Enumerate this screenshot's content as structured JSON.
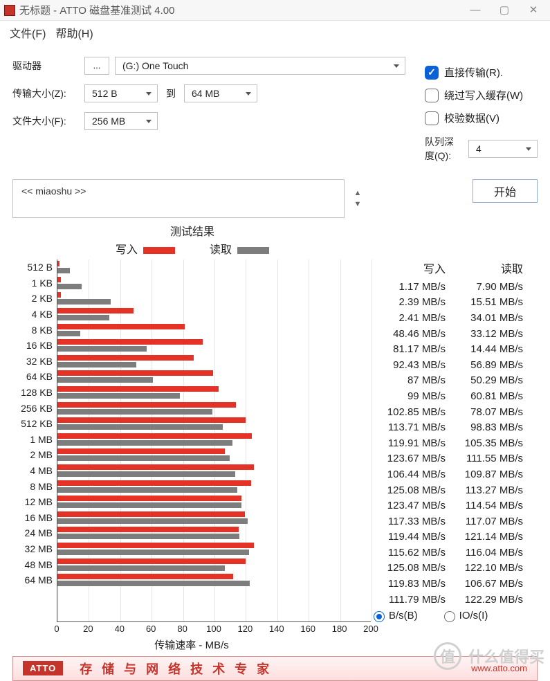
{
  "title": "无标题 - ATTO 磁盘基准测试 4.00",
  "menu": {
    "file": "文件(F)",
    "help": "帮助(H)"
  },
  "controls": {
    "drive_label": "驱动器",
    "browse": "...",
    "drive_value": "(G:) One Touch",
    "transfer_size_label": "传输大小(Z):",
    "transfer_from": "512 B",
    "to_word": "到",
    "transfer_to": "64 MB",
    "file_size_label": "文件大小(F):",
    "file_size_value": "256 MB"
  },
  "options": {
    "direct_io": "直接传输(R).",
    "direct_io_checked": true,
    "bypass_cache": "绕过写入缓存(W)",
    "bypass_cache_checked": false,
    "verify_data": "校验数据(V)",
    "verify_data_checked": false,
    "queue_depth_label": "队列深度(Q):",
    "queue_depth_value": "4",
    "start": "开始"
  },
  "description_placeholder": "<< miaoshu >>",
  "results_title": "测试结果",
  "legend": {
    "write": "写入",
    "read": "读取"
  },
  "table_head": {
    "write": "写入",
    "read": "读取"
  },
  "xaxis_title": "传输速率 - MB/s",
  "radios": {
    "bs": "B/s(B)",
    "io": "IO/s(I)",
    "selected": "bs"
  },
  "banner": {
    "logo": "ATTO",
    "slogan": "存储与网络技术专家",
    "url": "www.atto.com"
  },
  "watermark": "什么值得买",
  "unit": " MB/s",
  "chart_data": {
    "type": "bar",
    "title": "测试结果",
    "xlabel": "传输速率 - MB/s",
    "ylabel": "",
    "xlim": [
      0,
      200
    ],
    "xticks": [
      0,
      20,
      40,
      60,
      80,
      100,
      120,
      140,
      160,
      180,
      200
    ],
    "categories": [
      "512 B",
      "1 KB",
      "2 KB",
      "4 KB",
      "8 KB",
      "16 KB",
      "32 KB",
      "64 KB",
      "128 KB",
      "256 KB",
      "512 KB",
      "1 MB",
      "2 MB",
      "4 MB",
      "8 MB",
      "12 MB",
      "16 MB",
      "24 MB",
      "32 MB",
      "48 MB",
      "64 MB"
    ],
    "series": [
      {
        "name": "写入",
        "color": "#e53226",
        "values": [
          1.17,
          2.39,
          2.41,
          48.46,
          81.17,
          92.43,
          87,
          99,
          102.85,
          113.71,
          119.91,
          123.67,
          106.44,
          125.08,
          123.47,
          117.33,
          119.44,
          115.62,
          125.08,
          119.83,
          111.79
        ]
      },
      {
        "name": "读取",
        "color": "#7d7d7d",
        "values": [
          7.9,
          15.51,
          34.01,
          33.12,
          14.44,
          56.89,
          50.29,
          60.81,
          78.07,
          98.83,
          105.35,
          111.55,
          109.87,
          113.27,
          114.54,
          117.07,
          121.14,
          116.04,
          122.1,
          106.67,
          122.29
        ]
      }
    ]
  }
}
